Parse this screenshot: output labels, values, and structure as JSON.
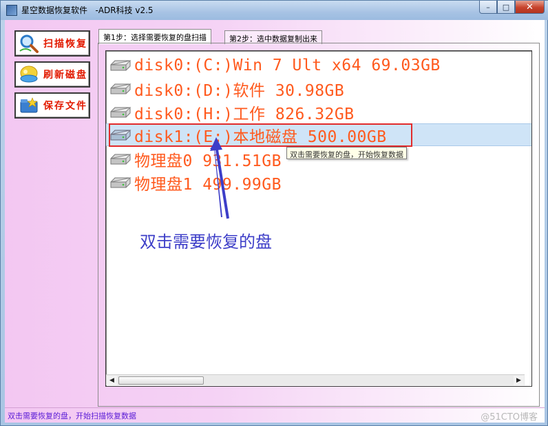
{
  "window": {
    "title": "星空数据恢复软件   -ADR科技 v2.5",
    "minimize_glyph": "–",
    "maximize_glyph": "□",
    "close_glyph": "✕"
  },
  "sidebar": {
    "buttons": [
      {
        "label": "扫描恢复",
        "icon": "magnifier-icon"
      },
      {
        "label": "刷新磁盘",
        "icon": "refresh-disk-icon"
      },
      {
        "label": "保存文件",
        "icon": "save-folder-icon"
      }
    ]
  },
  "tabs": [
    {
      "label": "第1步：选择需要恢复的盘扫描",
      "active": true
    },
    {
      "label": "第2步：选中数据复制出来",
      "active": false
    }
  ],
  "disks": [
    {
      "label": "disk0:(C:)Win 7 Ult x64 69.03GB"
    },
    {
      "label": "disk0:(D:)软件 30.98GB"
    },
    {
      "label": "disk0:(H:)工作 826.32GB"
    },
    {
      "label": "disk1:(E:)本地磁盘 500.00GB",
      "selected": true
    },
    {
      "label": "物理盘0 931.51GB"
    },
    {
      "label": "物理盘1 499.99GB"
    }
  ],
  "tooltip": "双击需要恢复的盘，开始恢复数据",
  "annotation": "双击需要恢复的盘",
  "status": "双击需要恢复的盘，开始扫描恢复数据",
  "watermark": "@51CTO博客",
  "colors": {
    "disk_text": "#ff5a1e",
    "button_text": "#e21a00",
    "annotation": "#3d3ec8",
    "highlight_box": "#e22b2b"
  }
}
